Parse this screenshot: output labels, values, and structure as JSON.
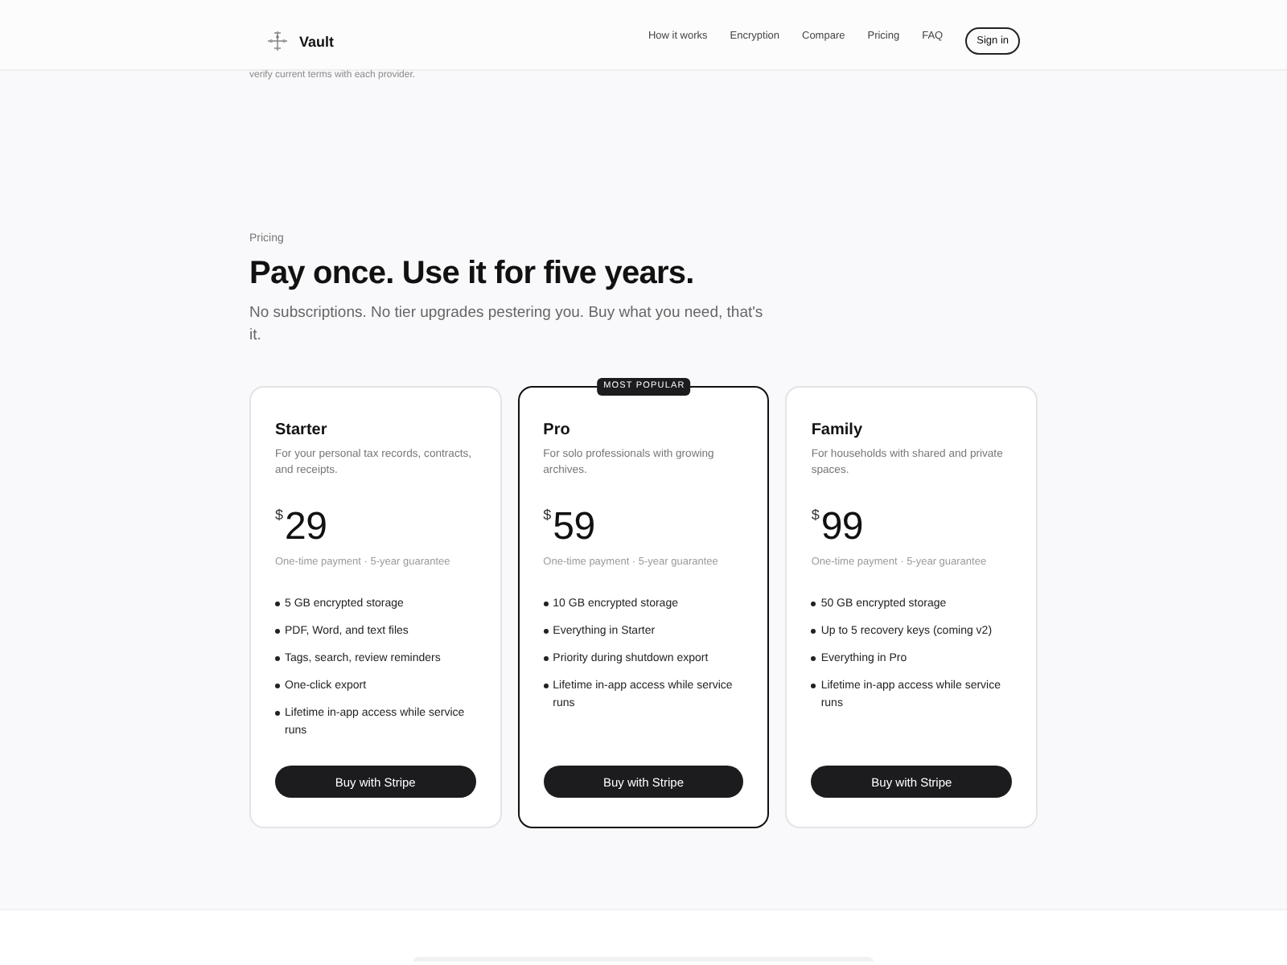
{
  "header": {
    "brand": "Vault",
    "nav": [
      "How it works",
      "Encryption",
      "Compare",
      "Pricing",
      "FAQ"
    ],
    "sign_in": "Sign in"
  },
  "previous_section": {
    "note": "verify current terms with each provider."
  },
  "pricing": {
    "eyebrow": "Pricing",
    "title": "Pay once. Use it for five years.",
    "subtitle": "No subscriptions. No tier upgrades pestering you. Buy what you need, that's it.",
    "plans": [
      {
        "name": "Starter",
        "description": "For your personal tax records, contracts, and receipts.",
        "currency": "$",
        "price": "29",
        "terms": "One-time payment · 5-year guarantee",
        "features": [
          "5 GB encrypted storage",
          "PDF, Word, and text files",
          "Tags, search, review reminders",
          "One-click export",
          "Lifetime in-app access while service runs"
        ],
        "button": "Buy with Stripe",
        "featured": false
      },
      {
        "name": "Pro",
        "description": "For solo professionals with growing archives.",
        "currency": "$",
        "price": "59",
        "terms": "One-time payment · 5-year guarantee",
        "features": [
          "10 GB encrypted storage",
          "Everything in Starter",
          "Priority during shutdown export",
          "Lifetime in-app access while service runs"
        ],
        "button": "Buy with Stripe",
        "featured": true,
        "badge": "MOST POPULAR"
      },
      {
        "name": "Family",
        "description": "For households with shared and private spaces.",
        "currency": "$",
        "price": "99",
        "terms": "One-time payment · 5-year guarantee",
        "features": [
          "50 GB encrypted storage",
          "Up to 5 recovery keys (coming v2)",
          "Everything in Pro",
          "Lifetime in-app access while service runs"
        ],
        "button": "Buy with Stripe",
        "featured": false
      }
    ]
  }
}
